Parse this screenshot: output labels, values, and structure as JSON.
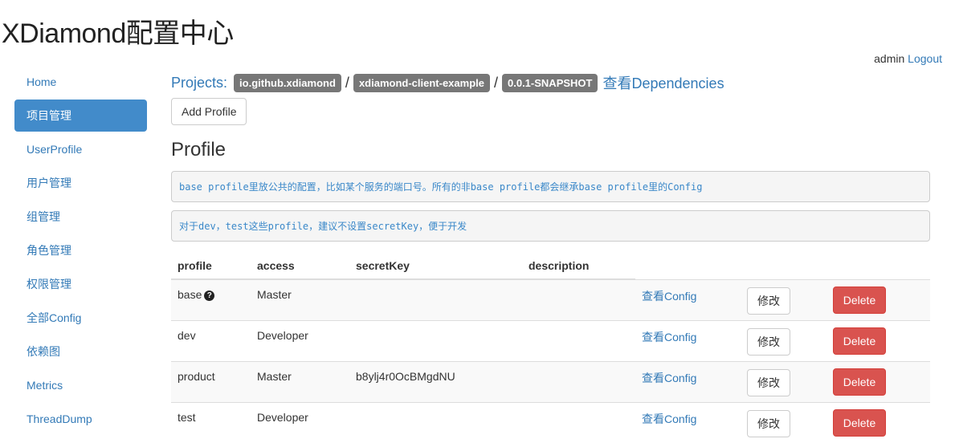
{
  "app_title": "XDiamond配置中心",
  "user": {
    "name": "admin",
    "logout": "Logout"
  },
  "sidebar": {
    "items": [
      {
        "label": "Home"
      },
      {
        "label": "项目管理",
        "active": true
      },
      {
        "label": "UserProfile"
      },
      {
        "label": "用户管理"
      },
      {
        "label": "组管理"
      },
      {
        "label": "角色管理"
      },
      {
        "label": "权限管理"
      },
      {
        "label": "全部Config"
      },
      {
        "label": "依赖图"
      },
      {
        "label": "Metrics"
      },
      {
        "label": "ThreadDump"
      }
    ]
  },
  "breadcrumb": {
    "projects_label": "Projects:",
    "group_id": "io.github.xdiamond",
    "artifact_id": "xdiamond-client-example",
    "version": "0.0.1-SNAPSHOT",
    "dependencies_link": "查看Dependencies"
  },
  "add_profile_label": "Add Profile",
  "section_title": "Profile",
  "notes": [
    "base profile里放公共的配置，比如某个服务的端口号。所有的非base profile都会继承base profile里的Config",
    "对于dev，test这些profile，建议不设置secretKey，便于开发"
  ],
  "table": {
    "headers": {
      "profile": "profile",
      "access": "access",
      "secret_key": "secretKey",
      "description": "description"
    },
    "rows": [
      {
        "profile": "base",
        "access": "Master",
        "secret_key": "",
        "description": "",
        "view": "查看Config",
        "edit": "修改",
        "delete": "Delete"
      },
      {
        "profile": "dev",
        "access": "Developer",
        "secret_key": "",
        "description": "",
        "view": "查看Config",
        "edit": "修改",
        "delete": "Delete"
      },
      {
        "profile": "product",
        "access": "Master",
        "secret_key": "b8ylj4r0OcBMgdNU",
        "description": "",
        "view": "查看Config",
        "edit": "修改",
        "delete": "Delete"
      },
      {
        "profile": "test",
        "access": "Developer",
        "secret_key": "",
        "description": "",
        "view": "查看Config",
        "edit": "修改",
        "delete": "Delete"
      }
    ]
  },
  "help_icon_glyph": "?"
}
